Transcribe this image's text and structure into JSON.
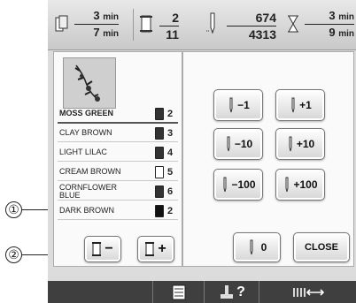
{
  "callouts": {
    "one": "①",
    "two": "②"
  },
  "status": {
    "stitch_time": {
      "top": "3",
      "top_unit": "min",
      "bottom": "7",
      "bottom_unit": "min"
    },
    "color_progress": {
      "top": "2",
      "bottom": "11"
    },
    "stitch_count": {
      "top": "674",
      "bottom": "4313"
    },
    "remaining_time": {
      "top": "3",
      "top_unit": "min",
      "bottom": "9",
      "bottom_unit": "min"
    }
  },
  "thread_list": [
    {
      "name": "MOSS GREEN",
      "number": "2",
      "spool_color": "#333333"
    },
    {
      "name": "CLAY BROWN",
      "number": "3",
      "spool_color": "#333333"
    },
    {
      "name": "LIGHT LILAC",
      "number": "4",
      "spool_color": "#333333"
    },
    {
      "name": "CREAM BROWN",
      "number": "5",
      "spool_color": "#ffffff"
    },
    {
      "name": "CORNFLOWER\nBLUE",
      "number": "6",
      "spool_color": "#333333"
    },
    {
      "name": "DARK BROWN",
      "number": "2",
      "spool_color": "#111111"
    }
  ],
  "step_buttons": {
    "minus1": "−1",
    "plus1": "+1",
    "minus10": "−10",
    "plus10": "+10",
    "minus100": "−100",
    "plus100": "+100",
    "zero": "0",
    "close": "CLOSE"
  },
  "color_step_buttons": {
    "back": "−",
    "forward": "+"
  },
  "bottom_bar": {
    "help": "?"
  }
}
